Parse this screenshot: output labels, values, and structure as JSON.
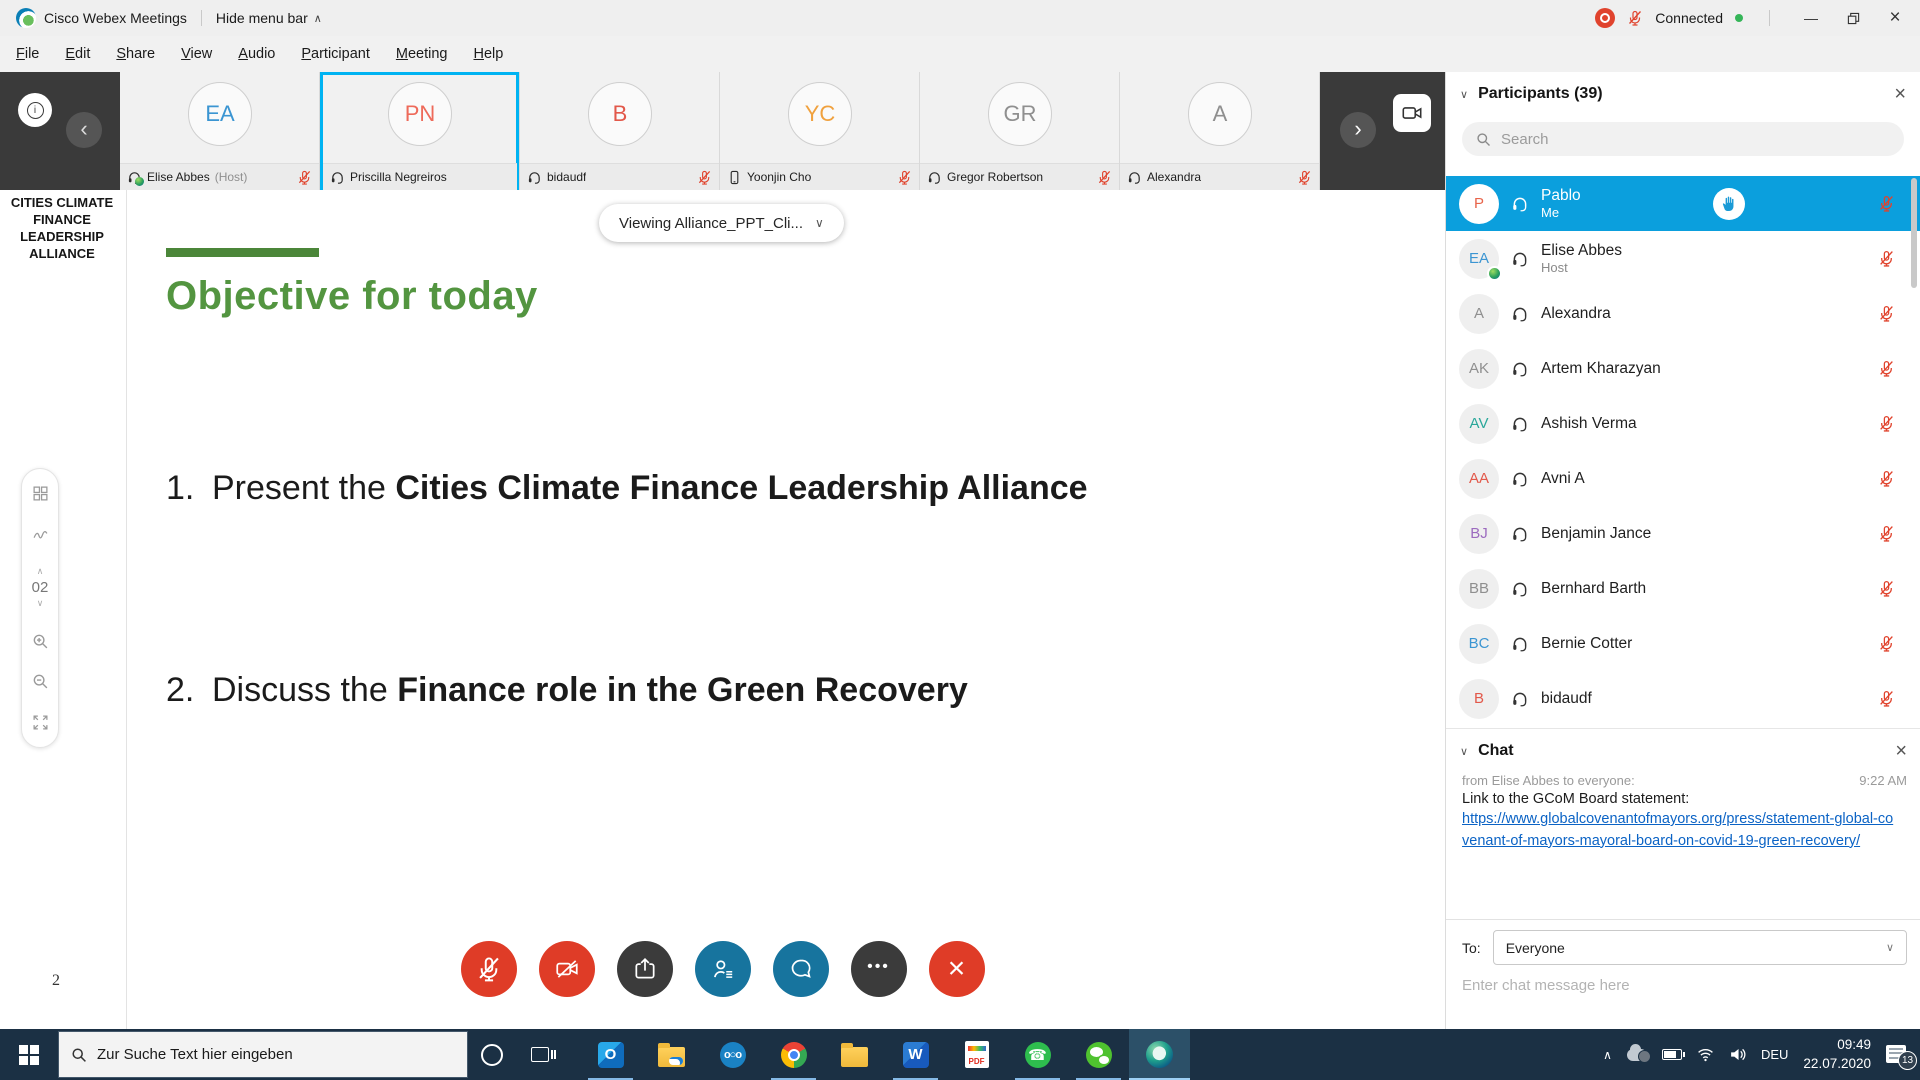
{
  "colors": {
    "accent_blue": "#0b9fdd",
    "selection_cyan": "#00b3f2",
    "alert_red": "#e0432d",
    "slide_green": "#539540",
    "link_blue": "#0b63c5",
    "taskbar_bg": "#1b3044"
  },
  "titlebar": {
    "app_name": "Cisco Webex Meetings",
    "hide_menu_label": "Hide menu bar",
    "connection_status": "Connected"
  },
  "menubar": {
    "items": [
      "File",
      "Edit",
      "Share",
      "View",
      "Audio",
      "Participant",
      "Meeting",
      "Help"
    ]
  },
  "video_strip": {
    "tiles": [
      {
        "initials": "EA",
        "color": "#3b95d2",
        "name": "Elise Abbes",
        "suffix": "(Host)",
        "device": "headset",
        "muted": true
      },
      {
        "initials": "PN",
        "color": "#ee6a5a",
        "name": "Priscilla Negreiros",
        "device": "headset",
        "muted": false,
        "selected": true
      },
      {
        "initials": "B",
        "color": "#e2584a",
        "name": "bidaudf",
        "device": "headset",
        "muted": true
      },
      {
        "initials": "YC",
        "color": "#f0a13e",
        "name": "Yoonjin Cho",
        "device": "phone",
        "muted": true
      },
      {
        "initials": "GR",
        "color": "#8f8f8f",
        "name": "Gregor Robertson",
        "device": "headset",
        "muted": true
      },
      {
        "initials": "A",
        "color": "#8f8f8f",
        "name": "Alexandra",
        "device": "headset",
        "muted": true
      }
    ]
  },
  "slide": {
    "logo_lines": [
      "CITIES CLIMATE",
      "FINANCE",
      "LEADERSHIP",
      "ALLIANCE"
    ],
    "viewing_label": "Viewing Alliance_PPT_Cli...",
    "title": "Objective for today",
    "items": [
      {
        "number": "1.",
        "prefix": "Present the ",
        "bold": "Cities Climate Finance Leadership Alliance"
      },
      {
        "number": "2.",
        "prefix": "Discuss the ",
        "bold": "Finance role in the Green Recovery"
      }
    ],
    "page_number": "2",
    "nav_page": "02"
  },
  "participants_panel": {
    "title": "Participants (39)",
    "search_placeholder": "Search",
    "people": [
      {
        "initials": "P",
        "color": "#e8644a",
        "name": "Pablo",
        "subtitle": "Me",
        "me": true,
        "hand_raised": true,
        "muted": true
      },
      {
        "initials": "EA",
        "color": "#3b95d2",
        "name": "Elise Abbes",
        "subtitle": "Host",
        "muted": true
      },
      {
        "initials": "A",
        "color": "#8f8f8f",
        "name": "Alexandra",
        "muted": true
      },
      {
        "initials": "AK",
        "color": "#8f8f8f",
        "name": "Artem Kharazyan",
        "muted": true
      },
      {
        "initials": "AV",
        "color": "#2aa79a",
        "name": "Ashish Verma",
        "muted": true
      },
      {
        "initials": "AA",
        "color": "#e2584a",
        "name": "Avni A",
        "muted": true
      },
      {
        "initials": "BJ",
        "color": "#9c6bbf",
        "name": "Benjamin Jance",
        "muted": true
      },
      {
        "initials": "BB",
        "color": "#8f8f8f",
        "name": "Bernhard Barth",
        "muted": true
      },
      {
        "initials": "BC",
        "color": "#3b95d2",
        "name": "Bernie Cotter",
        "muted": true
      },
      {
        "initials": "B",
        "color": "#e2584a",
        "name": "bidaudf",
        "muted": true
      }
    ]
  },
  "chat_panel": {
    "title": "Chat",
    "message": {
      "meta": "from Elise Abbes to everyone:",
      "time": "9:22 AM",
      "text": "Link to the GCoM Board statement:",
      "link": "https://www.globalcovenantofmayors.org/press/statement-global-covenant-of-mayors-mayoral-board-on-covid-19-green-recovery/"
    },
    "to_label": "To:",
    "to_value": "Everyone",
    "input_placeholder": "Enter chat message here"
  },
  "taskbar": {
    "search_placeholder": "Zur Suche Text hier eingeben",
    "tray": {
      "language": "DEU",
      "time": "09:49",
      "date": "22.07.2020",
      "notification_count": "13"
    }
  },
  "glyphs": {
    "chevron_down": "∨",
    "chevron_up": "∧",
    "chevron_left": "‹",
    "chevron_right": "›",
    "close": "×",
    "minimize": "—",
    "more": "•••",
    "nextcloud": "o○o",
    "whatsapp_phone": "☎",
    "info": "i",
    "pdf": "PDF"
  }
}
